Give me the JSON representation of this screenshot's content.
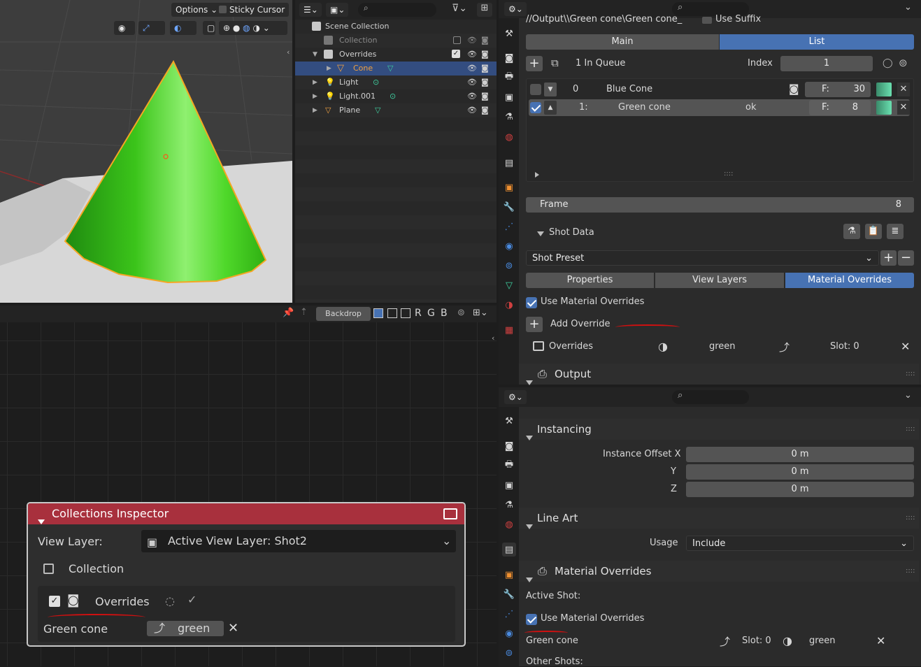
{
  "viewport": {
    "options_label": "Options",
    "sticky_cursor_label": "Sticky Cursor"
  },
  "outliner": {
    "items": [
      {
        "label": "Scene Collection"
      },
      {
        "label": "Collection"
      },
      {
        "label": "Overrides"
      },
      {
        "label": "Cone"
      },
      {
        "label": "Light"
      },
      {
        "label": "Light.001"
      },
      {
        "label": "Plane"
      }
    ]
  },
  "node_editor": {
    "backdrop_label": "Backdrop",
    "channels": [
      "R",
      "G",
      "B"
    ]
  },
  "inspector": {
    "title": "Collections Inspector",
    "view_layer_label": "View Layer:",
    "view_layer_value": "Active View Layer: Shot2",
    "collection_label": "Collection",
    "overrides_label": "Overrides",
    "green_cone_label": "Green cone",
    "material_value": "green"
  },
  "props_top": {
    "path": "//Output\\\\Green cone\\Green cone_",
    "use_suffix_label": "Use Suffix",
    "tabs": [
      "Main",
      "List"
    ],
    "queue_label": "1 In Queue",
    "index_label": "Index",
    "index_value": "1",
    "list": [
      {
        "num": "0",
        "name": "Blue Cone",
        "status": "",
        "frame_prefix": "F:",
        "frame": "30"
      },
      {
        "num": "1:",
        "name": "Green cone",
        "status": "ok",
        "frame_prefix": "F:",
        "frame": "8"
      }
    ],
    "frame_label": "Frame",
    "frame_value": "8",
    "shot_data_label": "Shot Data",
    "shot_preset_label": "Shot Preset",
    "subtabs": [
      "Properties",
      "View Layers",
      "Material Overrides"
    ],
    "use_mat_overrides_label": "Use Material Overrides",
    "add_override_label": "Add Override",
    "override_row": {
      "name": "Overrides",
      "material": "green",
      "slot": "Slot: 0"
    },
    "output_label": "Output"
  },
  "props_bottom": {
    "instancing_label": "Instancing",
    "instance_offset_x_label": "Instance Offset X",
    "y_label": "Y",
    "z_label": "Z",
    "offset_values": [
      "0 m",
      "0 m",
      "0 m"
    ],
    "line_art_label": "Line Art",
    "usage_label": "Usage",
    "usage_value": "Include",
    "mat_overrides_label": "Material Overrides",
    "active_shot_label": "Active Shot:",
    "use_mat_overrides_label": "Use Material Overrides",
    "green_cone_label": "Green cone",
    "slot_label": "Slot: 0",
    "material_value": "green",
    "other_shots_label": "Other Shots:"
  },
  "colors": {
    "accent": "#4772b3",
    "inspector_header": "#a8303d",
    "cone_green": "#3fd01a",
    "selection_orange": "#f5a623"
  }
}
